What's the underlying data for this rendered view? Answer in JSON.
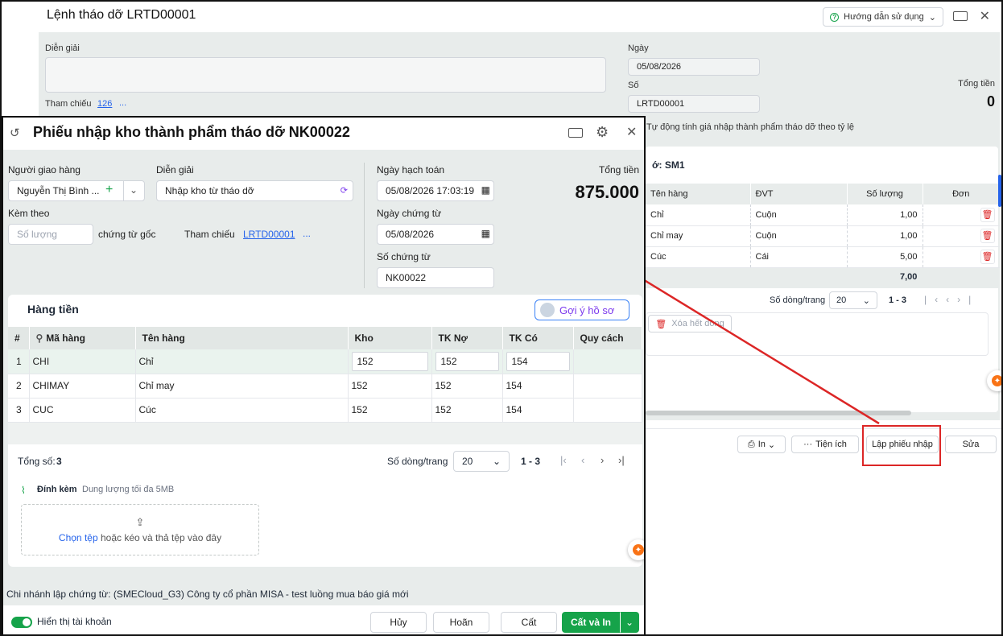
{
  "back": {
    "title": "Lệnh tháo dỡ LRTD00001",
    "help_label": "Hướng dẫn sử dụng",
    "dien_giai_label": "Diễn giải",
    "tham_chieu_label": "Tham chiếu",
    "tham_chieu_value": "126",
    "more": "...",
    "ngay_label": "Ngày",
    "ngay_value": "05/08/2026",
    "so_label": "Số",
    "so_value": "LRTD00001",
    "tong_tien_label": "Tổng tiền",
    "tong_tien_value": "0",
    "auto_price_text": "Tự động tính giá nhập thành phẩm tháo dỡ theo tỷ lệ",
    "section_title": "ớ: SM1",
    "columns": [
      "Tên hàng",
      "ĐVT",
      "Số lượng",
      "Đơn"
    ],
    "rows": [
      {
        "name": "Chỉ",
        "unit": "Cuộn",
        "qty": "1,00"
      },
      {
        "name": "Chỉ may",
        "unit": "Cuộn",
        "qty": "1,00"
      },
      {
        "name": "Cúc",
        "unit": "Cái",
        "qty": "5,00"
      }
    ],
    "total_qty": "7,00",
    "page_size_label": "Số dòng/trang",
    "page_size": "20",
    "page_range": "1 - 3",
    "delete_all": "Xóa hết dòng",
    "btn_print": "In",
    "btn_utils": "Tiện ích",
    "btn_create": "Lập phiếu nhập",
    "btn_edit": "Sửa"
  },
  "dialog": {
    "title": "Phiếu nhập kho thành phẩm tháo dỡ NK00022",
    "nguoi_giao_label": "Người giao hàng",
    "nguoi_giao_value": "Nguyễn Thị Bình ...",
    "dien_giai_label": "Diễn giải",
    "dien_giai_value": "Nhập kho từ tháo dỡ",
    "kem_theo_label": "Kèm theo",
    "so_luong_placeholder": "Số lượng",
    "chung_tu_goc": "chứng từ gốc",
    "tham_chieu_label": "Tham chiếu",
    "tham_chieu_value": "LRTD00001",
    "more": "...",
    "ngay_hach_toan_label": "Ngày hạch toán",
    "ngay_hach_toan_value": "05/08/2026 17:03:19",
    "ngay_chung_tu_label": "Ngày chứng từ",
    "ngay_chung_tu_value": "05/08/2026",
    "so_chung_tu_label": "Số chứng từ",
    "so_chung_tu_value": "NK00022",
    "tong_tien_label": "Tổng tiền",
    "tong_tien_value": "875.000",
    "section_title": "Hàng tiền",
    "suggest_label": "Gợi ý hồ sơ",
    "columns": [
      "#",
      "Mã hàng",
      "Tên hàng",
      "Kho",
      "TK Nợ",
      "TK Có",
      "Quy cách"
    ],
    "rows": [
      {
        "no": "1",
        "code": "CHI",
        "name": "Chỉ",
        "kho": "152",
        "no_acc": "152",
        "co_acc": "154"
      },
      {
        "no": "2",
        "code": "CHIMAY",
        "name": "Chỉ may",
        "kho": "152",
        "no_acc": "152",
        "co_acc": "154"
      },
      {
        "no": "3",
        "code": "CUC",
        "name": "Cúc",
        "kho": "152",
        "no_acc": "152",
        "co_acc": "154"
      }
    ],
    "tong_so_label": "Tổng số:",
    "tong_so_value": "3",
    "page_size_label": "Số dòng/trang",
    "page_size": "20",
    "page_range": "1 - 3",
    "attach_label": "Đính kèm",
    "attach_limit": "Dung lượng tối đa 5MB",
    "choose_file": "Chọn tệp",
    "drop_text": "hoặc kéo và thả tệp vào đây",
    "branch_text": "Chi nhánh lập chứng từ: (SMECloud_G3) Công ty cổ phần MISA - test luồng mua báo giá mới",
    "show_account": "Hiển thị tài khoản",
    "btn_cancel": "Hủy",
    "btn_undo": "Hoãn",
    "btn_save": "Cất",
    "btn_save_print": "Cất và In"
  },
  "colors": {
    "accent": "#16a34a",
    "annotation": "#dc2626",
    "link": "#2563eb"
  }
}
